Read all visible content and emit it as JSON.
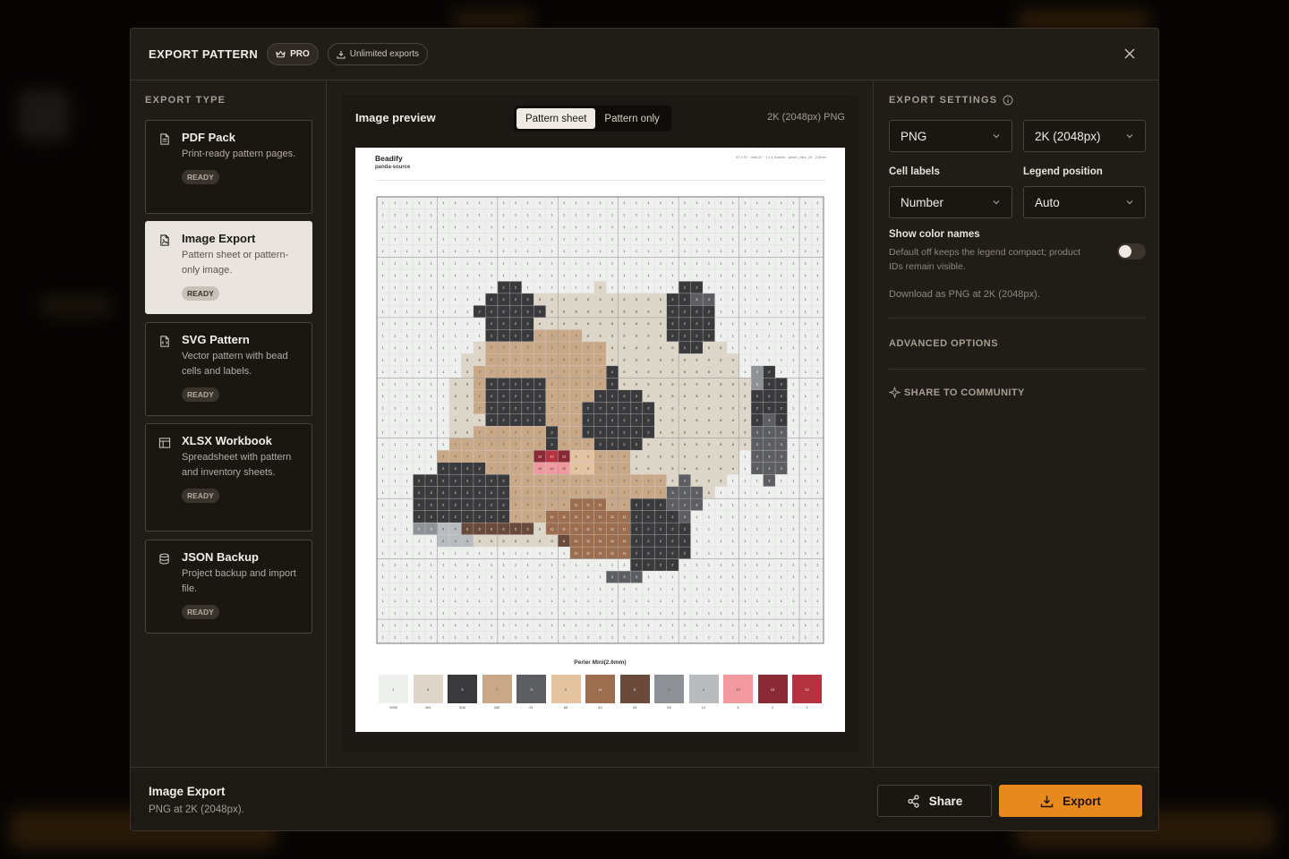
{
  "modal": {
    "title": "EXPORT PATTERN",
    "pro_label": "PRO",
    "unlimited_label": "Unlimited exports"
  },
  "export_type": {
    "heading": "EXPORT TYPE",
    "options": [
      {
        "title": "PDF Pack",
        "desc": "Print-ready pattern pages.",
        "badge": "READY",
        "icon": "document-icon",
        "selected": false
      },
      {
        "title": "Image Export",
        "desc": "Pattern sheet or pattern-only image.",
        "badge": "READY",
        "icon": "image-file-icon",
        "selected": true
      },
      {
        "title": "SVG Pattern",
        "desc": "Vector pattern with bead cells and labels.",
        "badge": "READY",
        "icon": "code-file-icon",
        "selected": false
      },
      {
        "title": "XLSX Workbook",
        "desc": "Spreadsheet with pattern and inventory sheets.",
        "badge": "READY",
        "icon": "table-icon",
        "selected": false
      },
      {
        "title": "JSON Backup",
        "desc": "Project backup and import file.",
        "badge": "READY",
        "icon": "database-icon",
        "selected": false
      }
    ]
  },
  "preview": {
    "title": "Image preview",
    "tabs": [
      "Pattern sheet",
      "Pattern only"
    ],
    "active_tab": "Pattern sheet",
    "resolution": "2K (2048px) PNG",
    "sheet": {
      "brand": "Beadify",
      "project": "panda-source",
      "meta": "37 x 37 · mini-37 · 1 x 1 boards · perler_mini_29 · 2.6mm",
      "legend_title": "Perler Mini(2.6mm)",
      "swatches": [
        {
          "color": "#eef0ee",
          "num": "1",
          "count": "1950"
        },
        {
          "color": "#ddd6c9",
          "num": "8",
          "count": "494"
        },
        {
          "color": "#3a3a3d",
          "num": "2",
          "count": "306"
        },
        {
          "color": "#c9a888",
          "num": "7",
          "count": "280"
        },
        {
          "color": "#5d5e62",
          "num": "3",
          "count": "91"
        },
        {
          "color": "#e3c3a0",
          "num": "9",
          "count": "65"
        },
        {
          "color": "#9c6e4f",
          "num": "11",
          "count": "44"
        },
        {
          "color": "#6a4a3b",
          "num": "6",
          "count": "43"
        },
        {
          "color": "#8e9297",
          "num": "5",
          "count": "28"
        },
        {
          "color": "#b9bcbe",
          "num": "4",
          "count": "12"
        },
        {
          "color": "#f09aa0",
          "num": "10",
          "count": "4"
        },
        {
          "color": "#8a2a36",
          "num": "13",
          "count": "2"
        },
        {
          "color": "#b33440",
          "num": "12",
          "count": "1"
        }
      ],
      "grid_size": 37
    }
  },
  "settings": {
    "heading": "EXPORT SETTINGS",
    "format": "PNG",
    "resolution": "2K (2048px)",
    "cell_labels_label": "Cell labels",
    "cell_labels_value": "Number",
    "legend_position_label": "Legend position",
    "legend_position_value": "Auto",
    "show_color_names_label": "Show color names",
    "show_color_names_desc": "Default off keeps the legend compact; product IDs remain visible.",
    "show_color_names_on": false,
    "download_note": "Download as PNG at 2K (2048px).",
    "advanced_label": "ADVANCED OPTIONS",
    "share_community_label": "SHARE TO COMMUNITY"
  },
  "footer": {
    "title": "Image Export",
    "subtitle": "PNG at 2K (2048px).",
    "share_label": "Share",
    "export_label": "Export"
  },
  "colors": {
    "accent": "#e8891e",
    "modal_bg": "#201c17"
  }
}
